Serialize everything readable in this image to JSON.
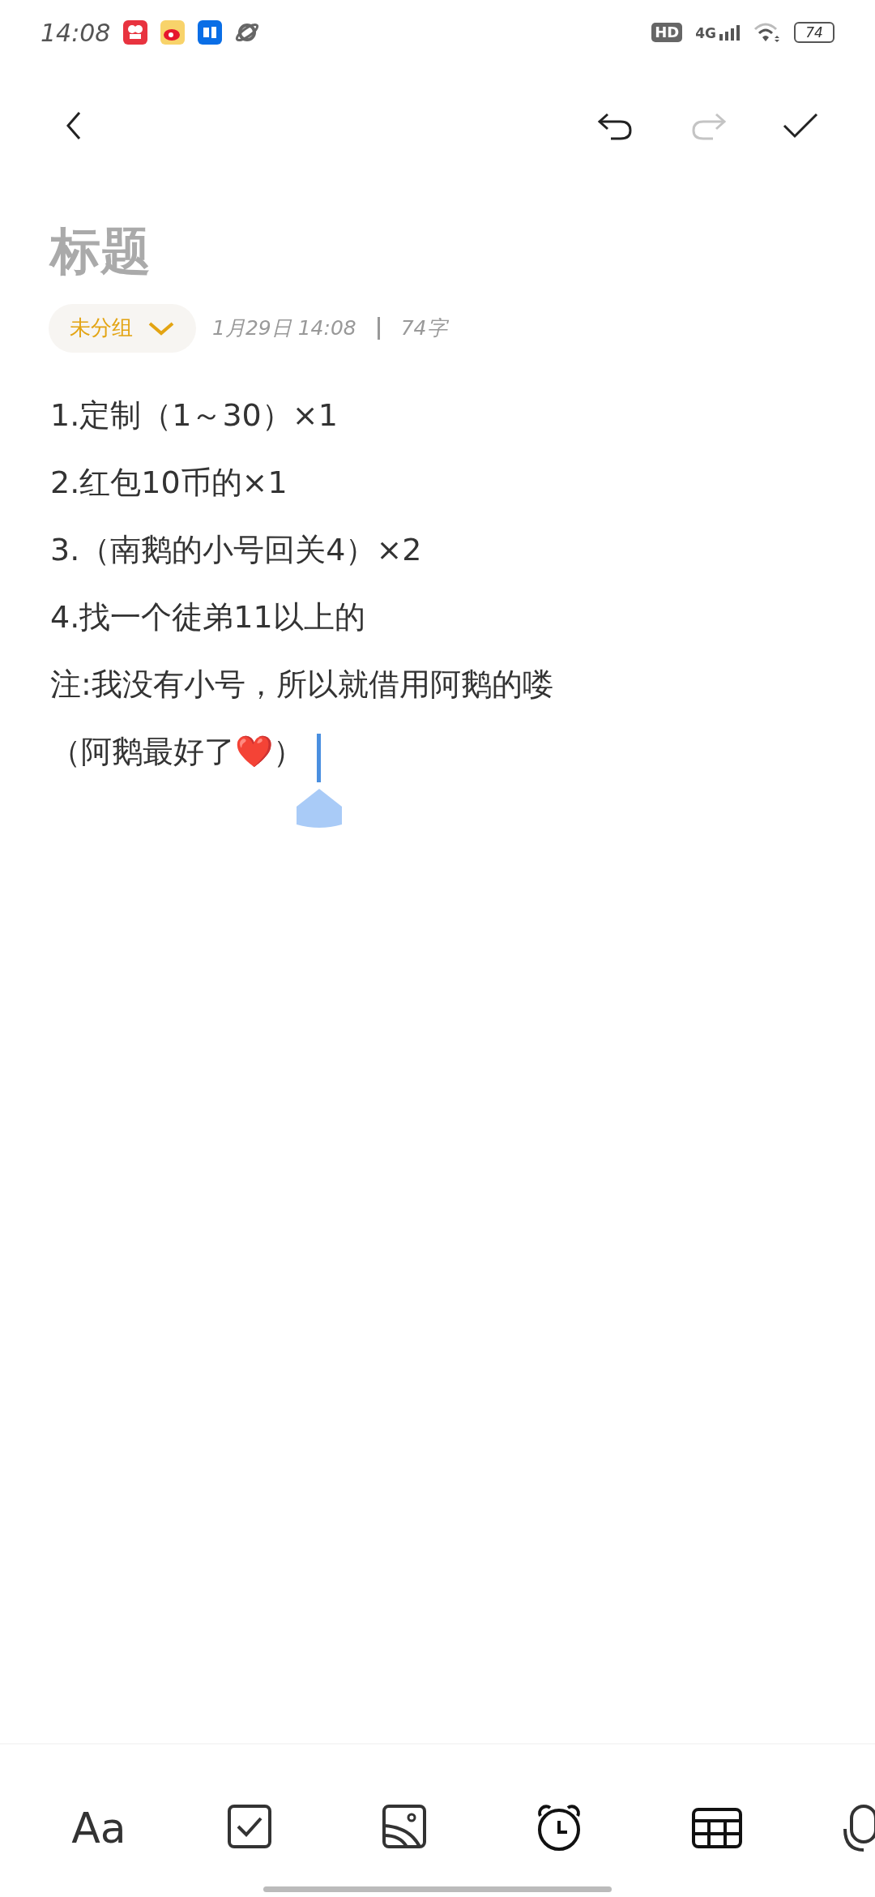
{
  "status_bar": {
    "time": "14:08",
    "apps": [
      {
        "kind": "video"
      },
      {
        "kind": "weibo"
      },
      {
        "kind": "zhihu"
      },
      {
        "kind": "planet"
      }
    ],
    "hd": "HD",
    "network": "4G",
    "battery": "74"
  },
  "header": {
    "actions": [
      {
        "kind": "undo",
        "disabled": false
      },
      {
        "kind": "redo",
        "disabled": true
      },
      {
        "kind": "done",
        "disabled": false
      }
    ]
  },
  "note": {
    "title_placeholder": "标题",
    "group": "未分组",
    "date": "1月29日 14:08",
    "word_count": "74字",
    "lines": [
      "1.定制（1～30）×1",
      "2.红包10币的×1",
      "3.（南鹅的小号回关4）×2",
      "4.找一个徒弟11以上的",
      "注:我没有小号，所以就借用阿鹅的喽",
      "（阿鹅最好了❤️）"
    ]
  },
  "toolbar": [
    {
      "kind": "format",
      "label": "Aa"
    },
    {
      "kind": "checklist"
    },
    {
      "kind": "image"
    },
    {
      "kind": "alarm"
    },
    {
      "kind": "table"
    },
    {
      "kind": "mic"
    }
  ]
}
